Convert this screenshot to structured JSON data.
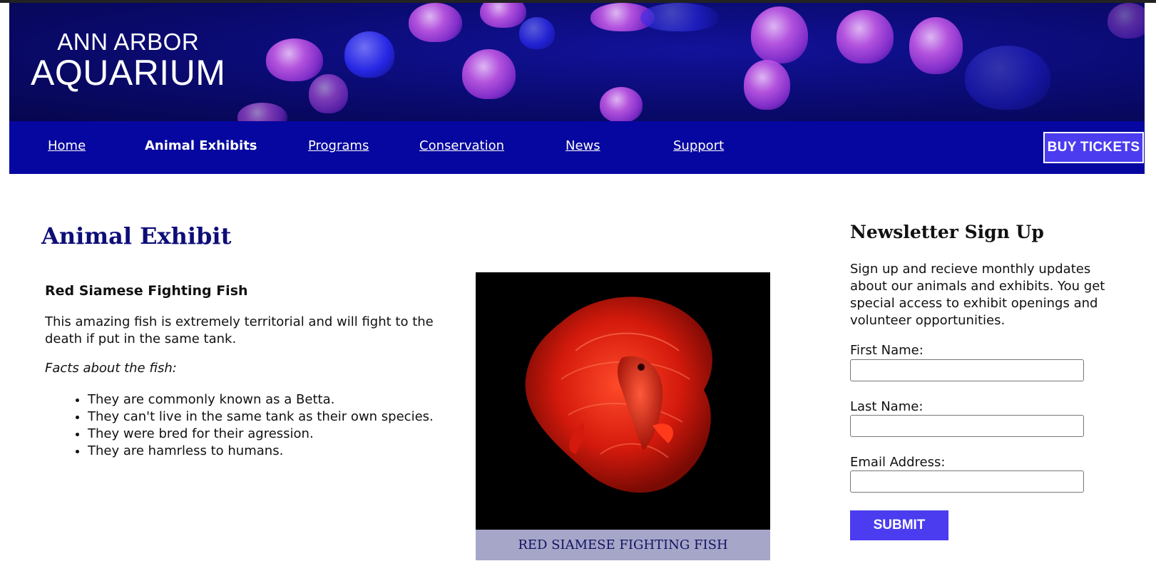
{
  "brand": {
    "line1": "ANN ARBOR",
    "line2": "AQUARIUM"
  },
  "nav": {
    "items": [
      {
        "label": "Home",
        "active": false
      },
      {
        "label": "Animal Exhibits",
        "active": true
      },
      {
        "label": "Programs",
        "active": false
      },
      {
        "label": "Conservation",
        "active": false
      },
      {
        "label": "News",
        "active": false
      },
      {
        "label": "Support",
        "active": false
      }
    ],
    "buy_tickets": "BUY TICKETS"
  },
  "main": {
    "title": "Animal Exhibit",
    "animal": {
      "name": "Red Siamese Fighting Fish",
      "description": "This amazing fish is extremely territorial and will fight to the death if put in the same tank.",
      "facts_label": "Facts about the fish:",
      "facts": [
        "They are commonly known as a Betta.",
        "They can't live in the same tank as their own species.",
        "They were bred for their agression.",
        "They are hamrless to humans."
      ],
      "image_caption": "RED SIAMESE FIGHTING FISH"
    }
  },
  "newsletter": {
    "title": "Newsletter Sign Up",
    "text": "Sign up and recieve monthly updates about our animals and exhibits. You get special access to exhibit openings and volunteer opportunities.",
    "fields": [
      {
        "label": "First Name:",
        "value": ""
      },
      {
        "label": "Last Name:",
        "value": ""
      },
      {
        "label": "Email Address:",
        "value": ""
      }
    ],
    "submit": "SUBMIT"
  },
  "colors": {
    "nav_bg": "#0606a0",
    "accent_button": "#4b3cf0",
    "title": "#0d0d78",
    "caption_bg": "#a6a6c8"
  }
}
